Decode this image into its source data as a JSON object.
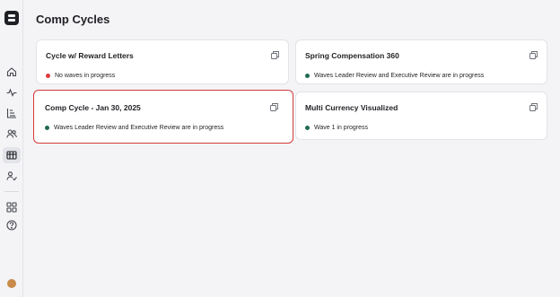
{
  "page": {
    "title": "Comp Cycles"
  },
  "colors": {
    "status_red": "#e03a3a",
    "status_green": "#1e6b4f",
    "selected_border": "#d43a3a"
  },
  "sidebar": {
    "items": [
      {
        "name": "home-icon"
      },
      {
        "name": "activity-icon"
      },
      {
        "name": "org-chart-icon"
      },
      {
        "name": "people-icon"
      },
      {
        "name": "comp-cycles-icon",
        "active": true
      },
      {
        "name": "user-check-icon"
      },
      {
        "name": "apps-grid-icon"
      },
      {
        "name": "help-icon"
      }
    ]
  },
  "cycles": [
    {
      "title": "Cycle w/ Reward Letters",
      "status": "No waves in progress",
      "status_color": "red"
    },
    {
      "title": "Spring Compensation 360",
      "status": "Waves Leader Review and Executive Review are in progress",
      "status_color": "green"
    },
    {
      "title": "Comp Cycle - Jan 30, 2025",
      "status": "Waves Leader Review and Executive Review are in progress",
      "status_color": "green",
      "selected": true
    },
    {
      "title": "Multi Currency Visualized",
      "status": "Wave 1 in progress",
      "status_color": "green"
    }
  ]
}
